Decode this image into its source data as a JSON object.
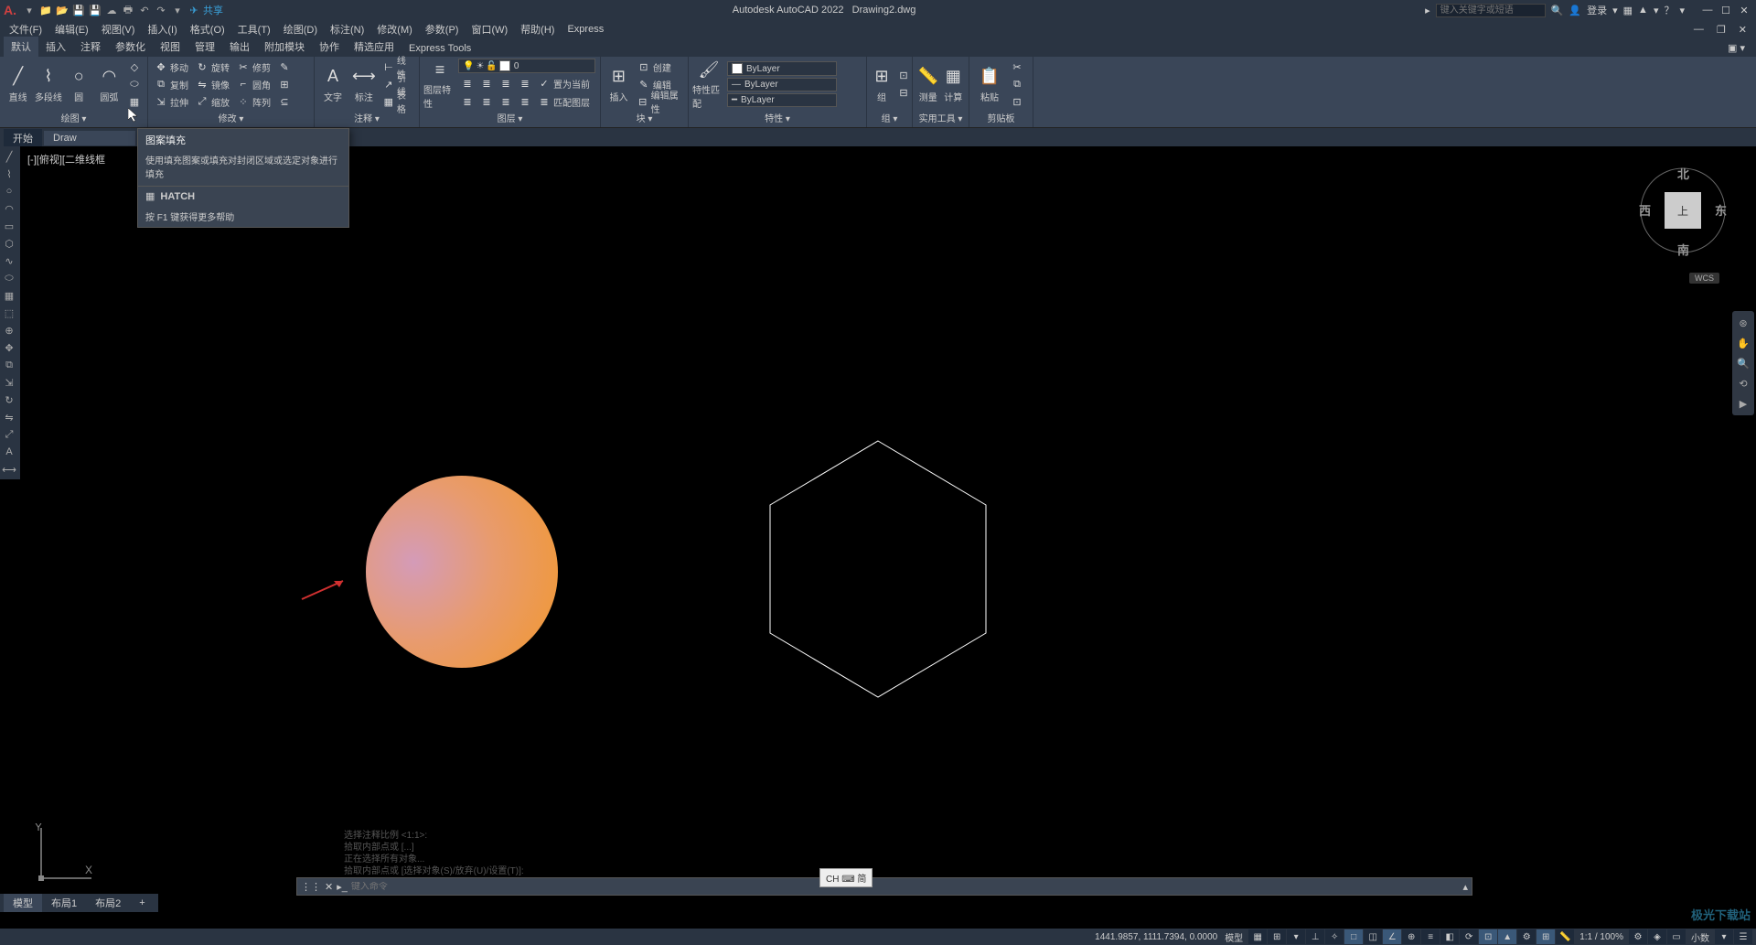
{
  "title_app": "Autodesk AutoCAD 2022",
  "title_file": "Drawing2.dwg",
  "share": "共享",
  "search_placeholder": "键入关键字或短语",
  "login": "登录",
  "menus": [
    "文件(F)",
    "编辑(E)",
    "视图(V)",
    "插入(I)",
    "格式(O)",
    "工具(T)",
    "绘图(D)",
    "标注(N)",
    "修改(M)",
    "参数(P)",
    "窗口(W)",
    "帮助(H)",
    "Express"
  ],
  "ribbon_tabs": [
    "默认",
    "插入",
    "注释",
    "参数化",
    "视图",
    "管理",
    "输出",
    "附加模块",
    "协作",
    "精选应用",
    "Express Tools"
  ],
  "draw": {
    "line": "直线",
    "pline": "多段线",
    "circle": "圆",
    "arc": "圆弧",
    "title": "绘图 ▾"
  },
  "modify": {
    "move": "移动",
    "rotate": "旋转",
    "trim": "修剪",
    "copy": "复制",
    "mirror": "镜像",
    "fillet": "圆角",
    "stretch": "拉伸",
    "scale": "缩放",
    "array": "阵列",
    "title": "修改 ▾"
  },
  "annot": {
    "text": "文字",
    "dim": "标注",
    "linear": "线性",
    "leader": "引线",
    "table": "表格",
    "title": "注释 ▾"
  },
  "layers": {
    "props": "图层特性",
    "current": "0",
    "setcur": "置为当前",
    "match": "匹配图层",
    "title": "图层 ▾"
  },
  "block": {
    "insert": "插入",
    "create": "创建",
    "edit": "编辑",
    "attr": "编辑属性",
    "title": "块 ▾"
  },
  "props": {
    "match": "特性匹配",
    "bylayer": "ByLayer",
    "title": "特性 ▾"
  },
  "group": {
    "group": "组",
    "title": "组 ▾"
  },
  "util": {
    "measure": "测量",
    "calc": "计算",
    "title": "实用工具 ▾"
  },
  "clip": {
    "paste": "粘贴",
    "title": "剪贴板"
  },
  "filetabs": {
    "start": "开始",
    "draw": "Draw"
  },
  "viewport": "[-][俯视][二维线框",
  "viewcube": {
    "n": "北",
    "s": "南",
    "e": "东",
    "w": "西",
    "top": "上",
    "wcs": "WCS"
  },
  "tooltip": {
    "title": "图案填充",
    "desc": "使用填充图案或填充对封闭区域或选定对象进行填充",
    "cmd": "HATCH",
    "help": "按 F1 键获得更多帮助"
  },
  "cmd_hist": [
    "选择注释比例 <1:1>:",
    "拾取内部点或 [...]",
    "正在选择所有对象...",
    "拾取内部点或 [选择对象(S)/放弃(U)/设置(T)]:"
  ],
  "cmd_prompt": "键入命令",
  "ime": "CH ⌨ 简",
  "layout_tabs": [
    "模型",
    "布局1",
    "布局2",
    "+"
  ],
  "coords": "1441.9857, 1111.7394, 0.0000",
  "status_model": "模型",
  "status_scale": "1:1 / 100%",
  "status_dec": "小数",
  "watermark": "极光下载站"
}
